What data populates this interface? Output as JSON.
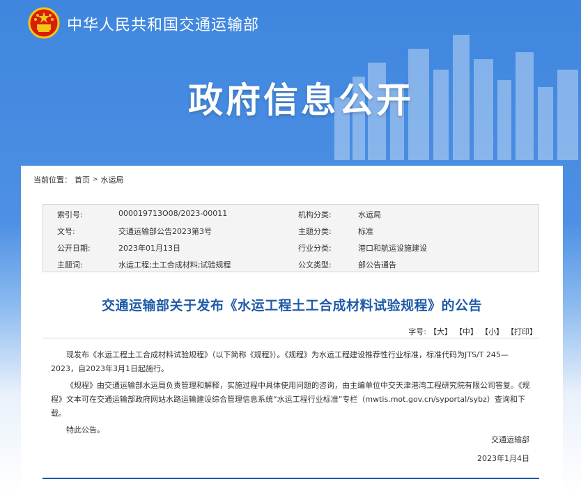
{
  "header": {
    "ministry_name": "中华人民共和国交通运输部",
    "banner_title": "政府信息公开",
    "emblem_icon": "national-emblem-icon"
  },
  "breadcrumb": {
    "label": "当前位置：",
    "home": "首页",
    "separator": ">",
    "current": "水运局"
  },
  "info": {
    "rows": [
      {
        "k1": "索引号:",
        "v1": "000019713O08/2023-00011",
        "k2": "机构分类:",
        "v2": "水运局"
      },
      {
        "k1": "文号:",
        "v1": "交通运输部公告2023第3号",
        "k2": "主题分类:",
        "v2": "标准"
      },
      {
        "k1": "公开日期:",
        "v1": "2023年01月13日",
        "k2": "行业分类:",
        "v2": "港口和航运设施建设"
      },
      {
        "k1": "主题词:",
        "v1": "水运工程;土工合成材料;试验规程",
        "k2": "公文类型:",
        "v2": "部公告通告"
      }
    ]
  },
  "article": {
    "title": "交通运输部关于发布《水运工程土工合成材料试验规程》的公告",
    "fontsize_label": "字号:",
    "font_large": "【大】",
    "font_medium": "【中】",
    "font_small": "【小】",
    "print": "【打印】",
    "paragraphs": [
      "现发布《水运工程土工合成材料试验规程》（以下简称《规程》）。《规程》为水运工程建设推荐性行业标准，标准代码为JTS/T 245—2023，自2023年3月1日起施行。",
      "《规程》由交通运输部水运局负责管理和解释，实施过程中具体使用问题的咨询，由主编单位中交天津港湾工程研究院有限公司答复。《规程》文本可在交通运输部政府网站水路运输建设综合管理信息系统“水运工程行业标准”专栏（mwtis.mot.gov.cn/syportal/sybz）查询和下载。",
      "特此公告。"
    ],
    "signature": "交通运输部",
    "sign_date": "2023年1月4日"
  },
  "colors": {
    "banner_blue": "#4a8de3",
    "title_blue": "#1f5ba8"
  }
}
